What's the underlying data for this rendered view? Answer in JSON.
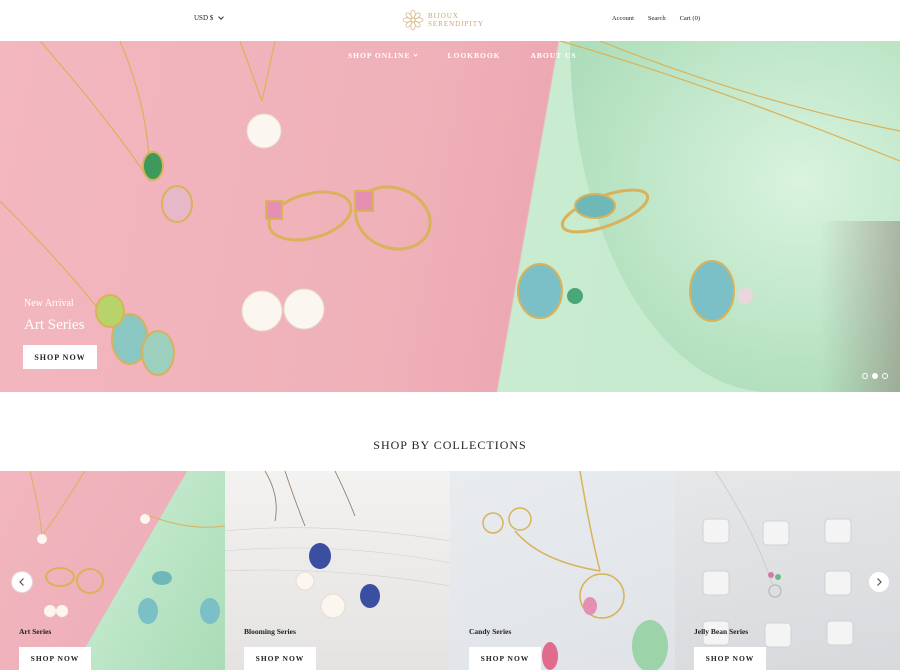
{
  "header": {
    "currency": "USD $",
    "logo_line1": "BIJOUX",
    "logo_line2": "SERENDIPITY",
    "account": "Account",
    "search": "Search",
    "cart": "Cart (0)"
  },
  "nav": {
    "items": [
      "SHOP ONLINE",
      "LOOKBOOK",
      "ABOUT US"
    ]
  },
  "hero": {
    "eyebrow": "New Arrival",
    "title": "Art Series",
    "button": "SHOP NOW",
    "slide_count": 3,
    "active_slide": 2
  },
  "collections": {
    "title": "SHOP BY COLLECTIONS",
    "items": [
      {
        "label": "Art Series",
        "button": "SHOP NOW"
      },
      {
        "label": "Blooming Series",
        "button": "SHOP NOW"
      },
      {
        "label": "Candy Series",
        "button": "SHOP NOW"
      },
      {
        "label": "Jelly Bean Series",
        "button": "SHOP NOW"
      }
    ]
  },
  "colors": {
    "accent_gold": "#c9a76e",
    "pink": "#f0b1b9",
    "mint": "#c2e8cb"
  }
}
